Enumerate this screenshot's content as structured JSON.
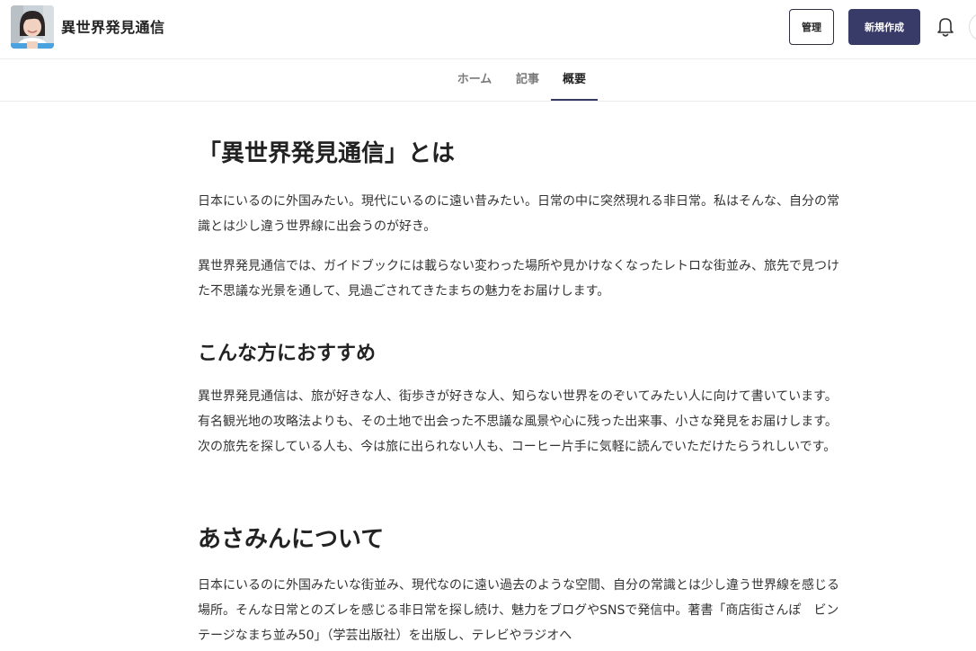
{
  "header": {
    "site_title": "異世界発見通信",
    "avatar_icon": "person-photo",
    "manage_label": "管理",
    "new_post_label": "新規作成",
    "bell_icon": "bell-icon"
  },
  "nav": {
    "tabs": [
      {
        "label": "ホーム",
        "active": false
      },
      {
        "label": "記事",
        "active": false
      },
      {
        "label": "概要",
        "active": true
      }
    ]
  },
  "content": {
    "title": "「異世界発見通信」とは",
    "intro_p1": "日本にいるのに外国みたい。現代にいるのに遠い昔みたい。日常の中に突然現れる非日常。私はそんな、自分の常識とは少し違う世界線に出会うのが好き。",
    "intro_p2": "異世界発見通信では、ガイドブックには載らない変わった場所や見かけなくなったレトロな街並み、旅先で見つけた不思議な光景を通して、見過ごされてきたまちの魅力をお届けします。",
    "section1_heading": "こんな方におすすめ",
    "section1_p": "異世界発見通信は、旅が好きな人、街歩きが好きな人、知らない世界をのぞいてみたい人に向けて書いています。有名観光地の攻略法よりも、その土地で出会った不思議な風景や心に残った出来事、小さな発見をお届けします。次の旅先を探している人も、今は旅に出られない人も、コーヒー片手に気軽に読んでいただけたらうれしいです。",
    "section2_heading": "あさみんについて",
    "section2_p": "日本にいるのに外国みたいな街並み、現代なのに遠い過去のような空間、自分の常識とは少し違う世界線を感じる場所。そんな日常とのズレを感じる非日常を探し続け、魅力をブログやSNSで発信中。著書「商店街さんぽ　ビンテージなまち並み50」（学芸出版社）を出版し、テレビやラジオへ"
  },
  "colors": {
    "accent": "#383a67",
    "border": "#ececec",
    "text": "#222222",
    "muted": "#7a7a7a"
  }
}
